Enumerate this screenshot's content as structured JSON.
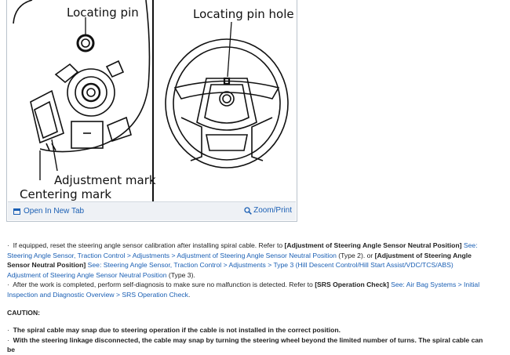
{
  "figure": {
    "label_locating_pin": "Locating pin",
    "label_locating_pin_hole": "Locating pin hole",
    "label_adjustment_mark": "Adjustment mark",
    "label_centering_mark": "Centering mark",
    "open_tab_label": "Open In New Tab",
    "zoom_label": "Zoom/Print"
  },
  "body": {
    "p1": {
      "bullet": "·",
      "t1": "If equipped, reset the steering angle sensor calibration after installing spiral cable. Refer to ",
      "b1": "[Adjustment of Steering Angle Sensor Neutral Position]",
      "l1": "See: Steering Angle Sensor, Traction Control > Adjustments > Adjustment of Steering Angle Sensor Neutral Position",
      "t2": " (Type 2). or ",
      "b2": "[Adjustment of Steering Angle Sensor Neutral Position]",
      "l2": "See: Steering Angle Sensor, Traction Control > Adjustments > Type 3 (Hill Descent Control/Hill Start Assist/VDC/TCS/ABS) Adjustment of Steering Angle Sensor Neutral Position",
      "t3": " (Type 3)."
    },
    "p2": {
      "bullet": "·",
      "t1": "After the work is completed, perform self-diagnosis to make sure no malfunction is detected. Refer to ",
      "b1": "[SRS Operation Check]",
      "l1": "See: Air Bag Systems > Initial Inspection and Diagnostic Overview > SRS Operation Check",
      "t2": "."
    },
    "caution_heading": "CAUTION:",
    "caution_items": [
      "The spiral cable may snap due to steering operation if the cable is not installed in the correct position.",
      "With the steering linkage disconnected, the cable may snap by turning the steering wheel beyond the limited number of turns. The spiral cable can be"
    ],
    "caution_bullet": "·"
  },
  "colors": {
    "link": "#1a5fb4",
    "toolbar": "#eef1f5"
  }
}
